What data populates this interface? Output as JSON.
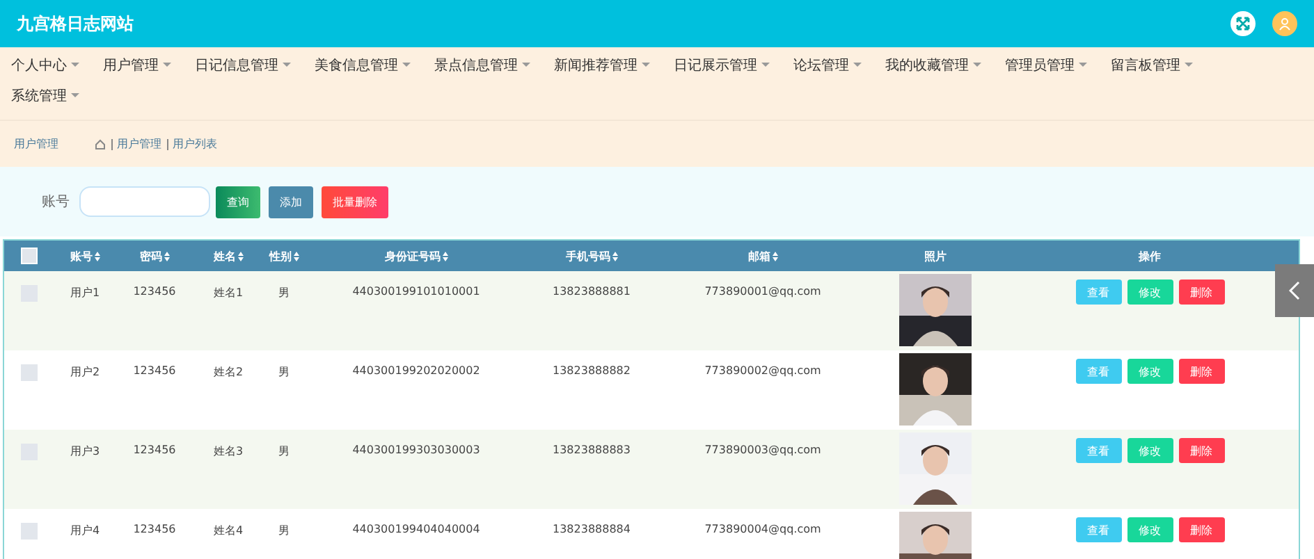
{
  "header": {
    "title": "九宫格日志网站"
  },
  "nav": [
    {
      "label": "个人中心"
    },
    {
      "label": "用户管理"
    },
    {
      "label": "日记信息管理"
    },
    {
      "label": "美食信息管理"
    },
    {
      "label": "景点信息管理"
    },
    {
      "label": "新闻推荐管理"
    },
    {
      "label": "日记展示管理"
    },
    {
      "label": "论坛管理"
    },
    {
      "label": "我的收藏管理"
    },
    {
      "label": "管理员管理"
    },
    {
      "label": "留言板管理"
    },
    {
      "label": "系统管理"
    }
  ],
  "breadcrumb": {
    "section": "用户管理",
    "path": [
      "用户管理",
      "用户列表"
    ]
  },
  "search": {
    "label": "账号",
    "buttons": [
      {
        "label": "查询",
        "kind": "search"
      },
      {
        "label": "添加",
        "kind": "add"
      },
      {
        "label": "批量删除",
        "kind": "delete"
      }
    ]
  },
  "table": {
    "select_all": {
      "checked": false
    },
    "columns": [
      "账号",
      "密码",
      "姓名",
      "性别",
      "身份证号码",
      "手机号码",
      "邮箱",
      "照片",
      "操作"
    ],
    "rows": [
      {
        "checked": false,
        "cells": [
          "用户1",
          "123456",
          "姓名1",
          "男",
          "440300199101010001",
          "13823888881",
          "773890001@qq.com"
        ],
        "photo": {
          "kind": "picture"
        },
        "actions": [
          "查看",
          "修改",
          "删除"
        ]
      },
      {
        "checked": false,
        "cells": [
          "用户2",
          "123456",
          "姓名2",
          "男",
          "440300199202020002",
          "13823888882",
          "773890002@qq.com"
        ],
        "photo": {
          "kind": "picture"
        },
        "actions": [
          "查看",
          "修改",
          "删除"
        ]
      },
      {
        "checked": false,
        "cells": [
          "用户3",
          "123456",
          "姓名3",
          "男",
          "440300199303030003",
          "13823888883",
          "773890003@qq.com"
        ],
        "photo": {
          "kind": "picture"
        },
        "actions": [
          "查看",
          "修改",
          "删除"
        ]
      },
      {
        "checked": false,
        "cells": [
          "用户4",
          "123456",
          "姓名4",
          "男",
          "440300199404040004",
          "13823888884",
          "773890004@qq.com"
        ],
        "photo": {
          "kind": "picture"
        },
        "actions": [
          "查看",
          "修改",
          "删除"
        ]
      }
    ]
  }
}
